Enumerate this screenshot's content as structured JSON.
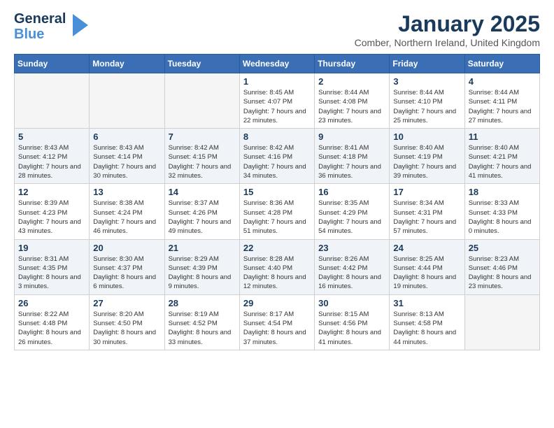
{
  "logo": {
    "line1a": "General",
    "line1b": "Blue",
    "icon": "▶"
  },
  "title": "January 2025",
  "location": "Comber, Northern Ireland, United Kingdom",
  "days_of_week": [
    "Sunday",
    "Monday",
    "Tuesday",
    "Wednesday",
    "Thursday",
    "Friday",
    "Saturday"
  ],
  "weeks": [
    [
      {
        "day": "",
        "empty": true
      },
      {
        "day": "",
        "empty": true
      },
      {
        "day": "",
        "empty": true
      },
      {
        "day": "1",
        "sunrise": "8:45 AM",
        "sunset": "4:07 PM",
        "daylight": "7 hours and 22 minutes."
      },
      {
        "day": "2",
        "sunrise": "8:44 AM",
        "sunset": "4:08 PM",
        "daylight": "7 hours and 23 minutes."
      },
      {
        "day": "3",
        "sunrise": "8:44 AM",
        "sunset": "4:10 PM",
        "daylight": "7 hours and 25 minutes."
      },
      {
        "day": "4",
        "sunrise": "8:44 AM",
        "sunset": "4:11 PM",
        "daylight": "7 hours and 27 minutes."
      }
    ],
    [
      {
        "day": "5",
        "sunrise": "8:43 AM",
        "sunset": "4:12 PM",
        "daylight": "7 hours and 28 minutes."
      },
      {
        "day": "6",
        "sunrise": "8:43 AM",
        "sunset": "4:14 PM",
        "daylight": "7 hours and 30 minutes."
      },
      {
        "day": "7",
        "sunrise": "8:42 AM",
        "sunset": "4:15 PM",
        "daylight": "7 hours and 32 minutes."
      },
      {
        "day": "8",
        "sunrise": "8:42 AM",
        "sunset": "4:16 PM",
        "daylight": "7 hours and 34 minutes."
      },
      {
        "day": "9",
        "sunrise": "8:41 AM",
        "sunset": "4:18 PM",
        "daylight": "7 hours and 36 minutes."
      },
      {
        "day": "10",
        "sunrise": "8:40 AM",
        "sunset": "4:19 PM",
        "daylight": "7 hours and 39 minutes."
      },
      {
        "day": "11",
        "sunrise": "8:40 AM",
        "sunset": "4:21 PM",
        "daylight": "7 hours and 41 minutes."
      }
    ],
    [
      {
        "day": "12",
        "sunrise": "8:39 AM",
        "sunset": "4:23 PM",
        "daylight": "7 hours and 43 minutes."
      },
      {
        "day": "13",
        "sunrise": "8:38 AM",
        "sunset": "4:24 PM",
        "daylight": "7 hours and 46 minutes."
      },
      {
        "day": "14",
        "sunrise": "8:37 AM",
        "sunset": "4:26 PM",
        "daylight": "7 hours and 49 minutes."
      },
      {
        "day": "15",
        "sunrise": "8:36 AM",
        "sunset": "4:28 PM",
        "daylight": "7 hours and 51 minutes."
      },
      {
        "day": "16",
        "sunrise": "8:35 AM",
        "sunset": "4:29 PM",
        "daylight": "7 hours and 54 minutes."
      },
      {
        "day": "17",
        "sunrise": "8:34 AM",
        "sunset": "4:31 PM",
        "daylight": "7 hours and 57 minutes."
      },
      {
        "day": "18",
        "sunrise": "8:33 AM",
        "sunset": "4:33 PM",
        "daylight": "8 hours and 0 minutes."
      }
    ],
    [
      {
        "day": "19",
        "sunrise": "8:31 AM",
        "sunset": "4:35 PM",
        "daylight": "8 hours and 3 minutes."
      },
      {
        "day": "20",
        "sunrise": "8:30 AM",
        "sunset": "4:37 PM",
        "daylight": "8 hours and 6 minutes."
      },
      {
        "day": "21",
        "sunrise": "8:29 AM",
        "sunset": "4:39 PM",
        "daylight": "8 hours and 9 minutes."
      },
      {
        "day": "22",
        "sunrise": "8:28 AM",
        "sunset": "4:40 PM",
        "daylight": "8 hours and 12 minutes."
      },
      {
        "day": "23",
        "sunrise": "8:26 AM",
        "sunset": "4:42 PM",
        "daylight": "8 hours and 16 minutes."
      },
      {
        "day": "24",
        "sunrise": "8:25 AM",
        "sunset": "4:44 PM",
        "daylight": "8 hours and 19 minutes."
      },
      {
        "day": "25",
        "sunrise": "8:23 AM",
        "sunset": "4:46 PM",
        "daylight": "8 hours and 23 minutes."
      }
    ],
    [
      {
        "day": "26",
        "sunrise": "8:22 AM",
        "sunset": "4:48 PM",
        "daylight": "8 hours and 26 minutes."
      },
      {
        "day": "27",
        "sunrise": "8:20 AM",
        "sunset": "4:50 PM",
        "daylight": "8 hours and 30 minutes."
      },
      {
        "day": "28",
        "sunrise": "8:19 AM",
        "sunset": "4:52 PM",
        "daylight": "8 hours and 33 minutes."
      },
      {
        "day": "29",
        "sunrise": "8:17 AM",
        "sunset": "4:54 PM",
        "daylight": "8 hours and 37 minutes."
      },
      {
        "day": "30",
        "sunrise": "8:15 AM",
        "sunset": "4:56 PM",
        "daylight": "8 hours and 41 minutes."
      },
      {
        "day": "31",
        "sunrise": "8:13 AM",
        "sunset": "4:58 PM",
        "daylight": "8 hours and 44 minutes."
      },
      {
        "day": "",
        "empty": true
      }
    ]
  ],
  "alt_rows": [
    1,
    3
  ],
  "labels": {
    "sunrise": "Sunrise:",
    "sunset": "Sunset:",
    "daylight": "Daylight:"
  }
}
